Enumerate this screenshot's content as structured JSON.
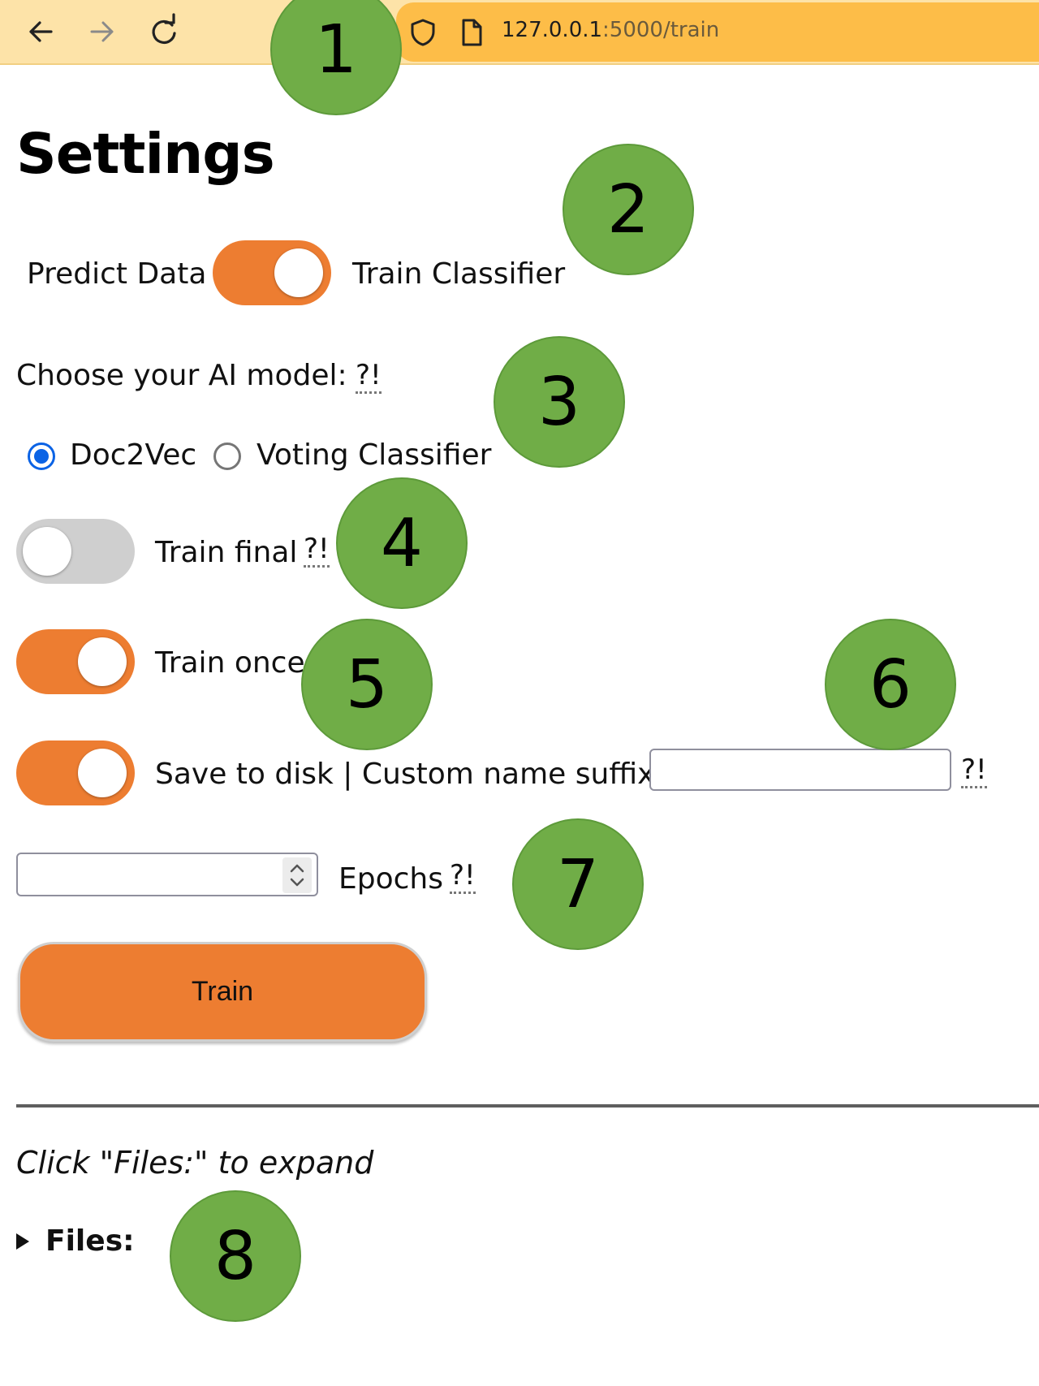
{
  "browser": {
    "url_host": "127.0.0.1",
    "url_path": ":5000/train",
    "icons": [
      "back-arrow-icon",
      "forward-arrow-icon",
      "reload-icon",
      "shield-icon",
      "page-icon"
    ]
  },
  "page": {
    "title": "Settings",
    "mode_toggle": {
      "left_label": "Predict Data",
      "right_label": "Train Classifier",
      "state": "on"
    },
    "model_prompt": "Choose your AI model:",
    "help_mark": "?!",
    "models": [
      {
        "label": "Doc2Vec",
        "checked": true
      },
      {
        "label": "Voting Classifier",
        "checked": false
      }
    ],
    "train_final": {
      "label": "Train final",
      "state": "off"
    },
    "train_once": {
      "label": "Train once",
      "state": "on"
    },
    "save_to_disk": {
      "label": "Save to disk | Custom name suffix",
      "state": "on",
      "suffix_value": ""
    },
    "epochs": {
      "label": "Epochs",
      "value": ""
    },
    "train_button": "Train",
    "files_hint": "Click \"Files:\" to expand",
    "files_label": "Files:"
  },
  "annotations": [
    "1",
    "2",
    "3",
    "4",
    "5",
    "6",
    "7",
    "8"
  ],
  "colors": {
    "accent_orange": "#ed7d31",
    "marker_green": "#70ad47",
    "radio_blue": "#0b63e5",
    "toolbar_bg": "#fde3a8",
    "urlbar_bg": "#fdbd48"
  }
}
